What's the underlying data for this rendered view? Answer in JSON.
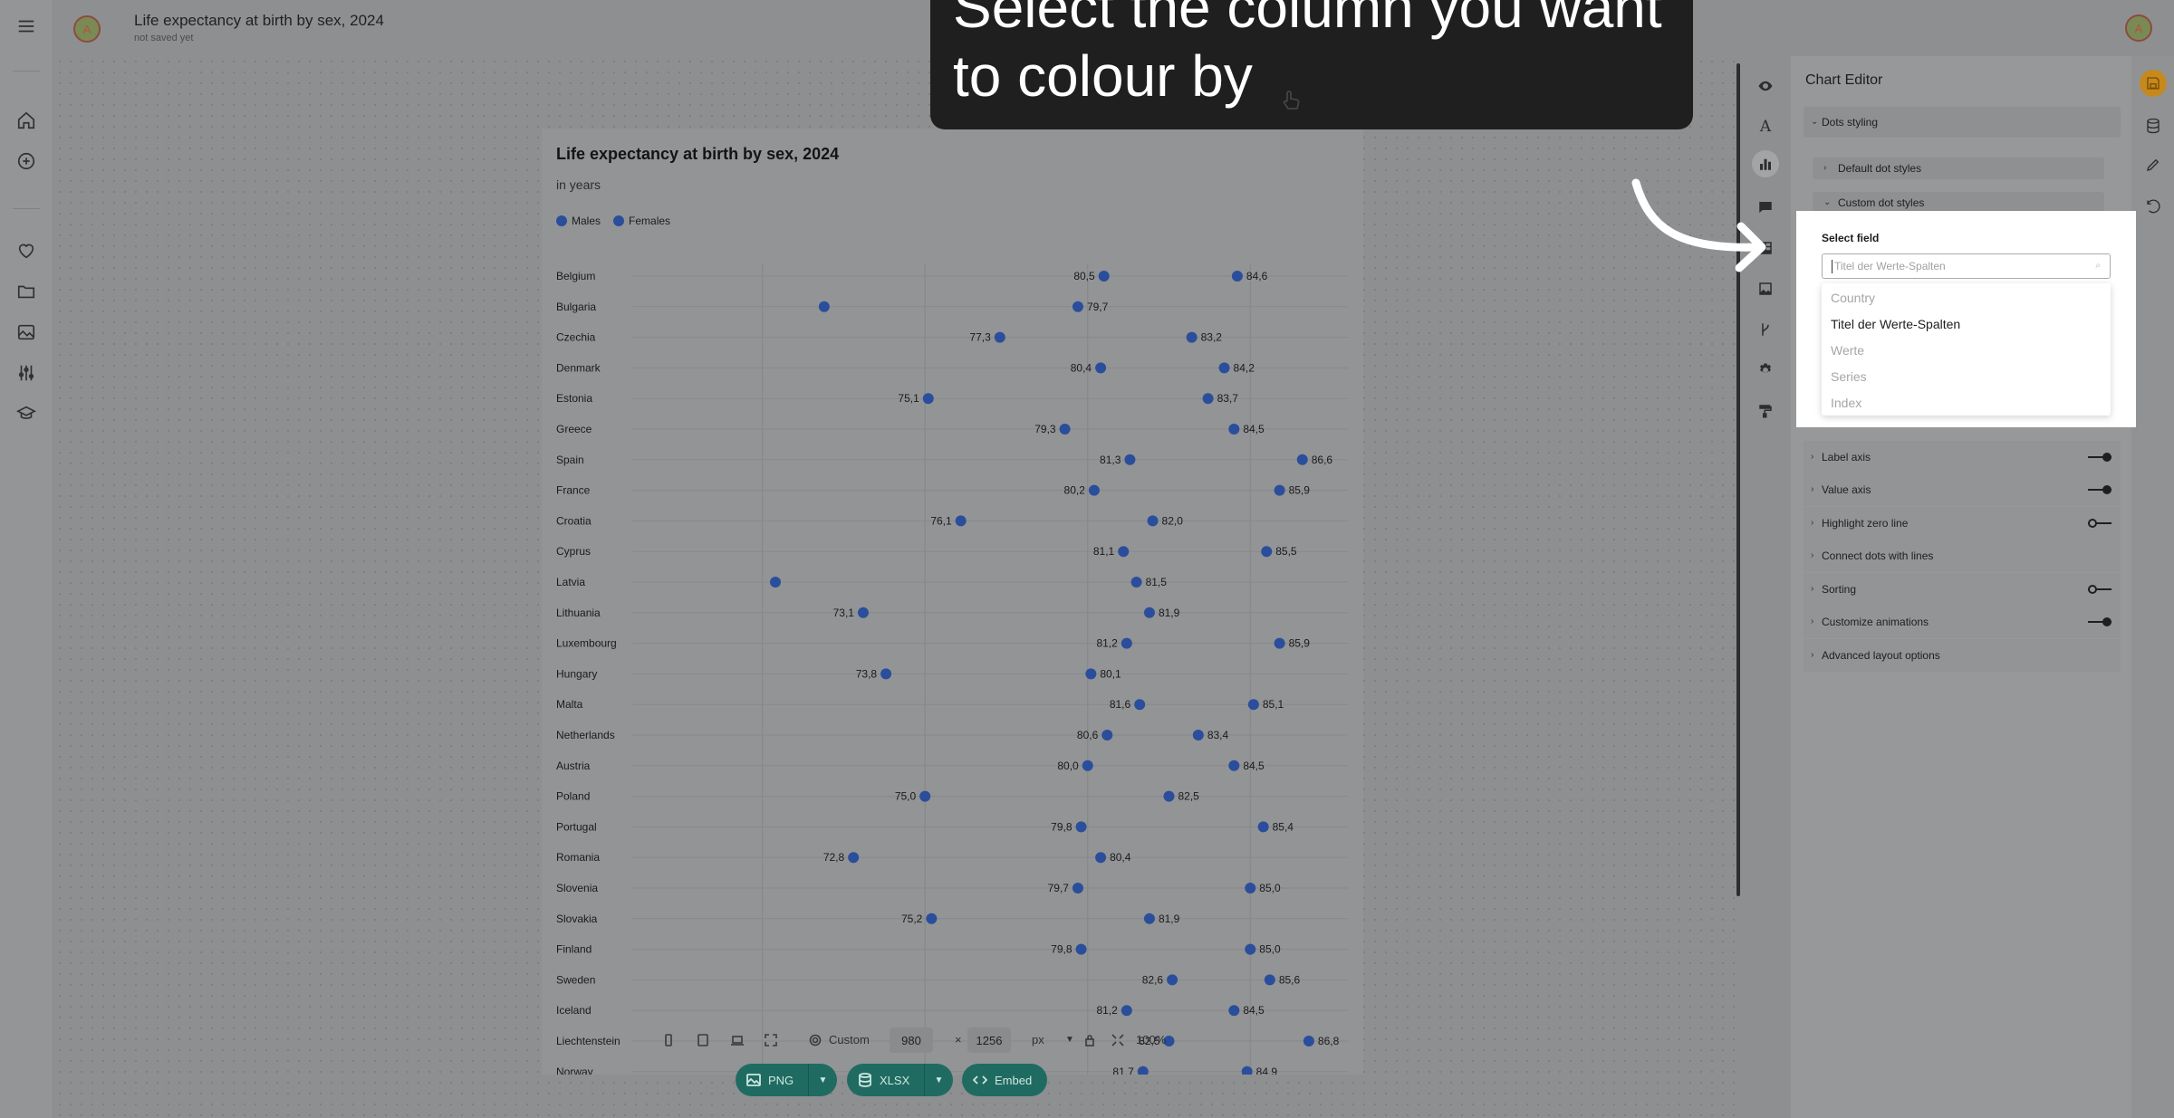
{
  "topbar": {
    "avatar_letter": "A",
    "title": "Life expectancy at birth by sex, 2024",
    "subtitle": "not saved yet",
    "user_avatar_letter": "A"
  },
  "left_rail_icons": [
    "menu-icon",
    "home-icon",
    "add-icon",
    "heart-icon",
    "folder-icon",
    "image-icon",
    "sliders-icon",
    "graduation-cap-icon"
  ],
  "chart": {
    "title": "Life expectancy at birth by sex, 2024",
    "subtitle": "in years",
    "legend": [
      "Males",
      "Females"
    ]
  },
  "chart_data": {
    "type": "scatter",
    "title": "Life expectancy at birth by sex, 2024",
    "subtitle": "in years",
    "categories": [
      "Belgium",
      "Bulgaria",
      "Czechia",
      "Denmark",
      "Estonia",
      "Greece",
      "Spain",
      "France",
      "Croatia",
      "Cyprus",
      "Latvia",
      "Lithuania",
      "Luxembourg",
      "Hungary",
      "Malta",
      "Netherlands",
      "Austria",
      "Poland",
      "Portugal",
      "Romania",
      "Slovenia",
      "Slovakia",
      "Finland",
      "Sweden",
      "Iceland",
      "Liechtenstein",
      "Norway"
    ],
    "series": [
      {
        "name": "Males",
        "values": [
          80.5,
          71.9,
          77.3,
          80.4,
          75.1,
          79.3,
          81.3,
          80.2,
          76.1,
          81.1,
          70.4,
          73.1,
          81.2,
          73.8,
          81.6,
          80.6,
          80.0,
          75.0,
          79.8,
          72.8,
          79.7,
          75.2,
          79.8,
          82.6,
          81.2,
          82.5,
          81.7
        ],
        "labels": [
          "80,5",
          "",
          "77,3",
          "80,4",
          "75,1",
          "79,3",
          "81,3",
          "80,2",
          "76,1",
          "81,1",
          "",
          "73,1",
          "81,2",
          "73,8",
          "81,6",
          "80,6",
          "80,0",
          "75,0",
          "79,8",
          "72,8",
          "79,7",
          "75,2",
          "79,8",
          "82,6",
          "81,2",
          "82,5",
          "81,7"
        ]
      },
      {
        "name": "Females",
        "values": [
          84.6,
          79.7,
          83.2,
          84.2,
          83.7,
          84.5,
          86.6,
          85.9,
          82.0,
          85.5,
          81.5,
          81.9,
          85.9,
          80.1,
          85.1,
          83.4,
          84.5,
          82.5,
          85.4,
          80.4,
          85.0,
          81.9,
          85.0,
          85.6,
          84.5,
          86.8,
          84.9
        ],
        "labels": [
          "84,6",
          "79,7",
          "83,2",
          "84,2",
          "83,7",
          "84,5",
          "86,6",
          "85,9",
          "82,0",
          "85,5",
          "81,5",
          "81,9",
          "85,9",
          "80,1",
          "85,1",
          "83,4",
          "84,5",
          "82,5",
          "85,4",
          "80,4",
          "85,0",
          "81,9",
          "85,0",
          "85,6",
          "84,5",
          "86,8",
          "84,9"
        ]
      }
    ],
    "xlim": [
      66,
      88
    ],
    "grid": true,
    "legend_position": "top-left"
  },
  "tools": [
    "eye-icon",
    "typography-icon",
    "bar-chart-icon",
    "comment-icon",
    "table-icon",
    "picture-icon",
    "branch-icon",
    "gear-icon",
    "paint-roller-icon"
  ],
  "editor": {
    "title": "Chart Editor",
    "sections": {
      "dots_styling": "Dots styling",
      "default_dot_styles": "Default dot styles",
      "custom_dot_styles": "Custom dot styles"
    },
    "rows": [
      {
        "label": "Label axis",
        "toggle": "on"
      },
      {
        "label": "Value axis",
        "toggle": "on"
      },
      {
        "label": "Highlight zero line",
        "toggle": "off"
      },
      {
        "label": "Connect dots with lines",
        "toggle": "none"
      },
      {
        "label": "Sorting",
        "toggle": "off"
      },
      {
        "label": "Customize animations",
        "toggle": "on"
      },
      {
        "label": "Advanced layout options",
        "toggle": "none"
      }
    ]
  },
  "select_field": {
    "label": "Select field",
    "placeholder": "Titel der Werte-Spalten",
    "options": [
      "Country",
      "Titel der Werte-Spalten",
      "Werte",
      "Series",
      "Index"
    ],
    "selected_index": 1
  },
  "banner": {
    "text": "Select the column you want to colour by"
  },
  "bottom_toolbar": {
    "preset": "Custom",
    "width": "980",
    "times": "×",
    "height": "1256",
    "unit": "px",
    "zoom": "100%"
  },
  "export": {
    "png": "PNG",
    "xlsx": "XLSX",
    "embed": "Embed"
  },
  "colors": {
    "dot": "#2a4e9b",
    "accent": "#1f6b61",
    "save_button": "#c5891e"
  }
}
